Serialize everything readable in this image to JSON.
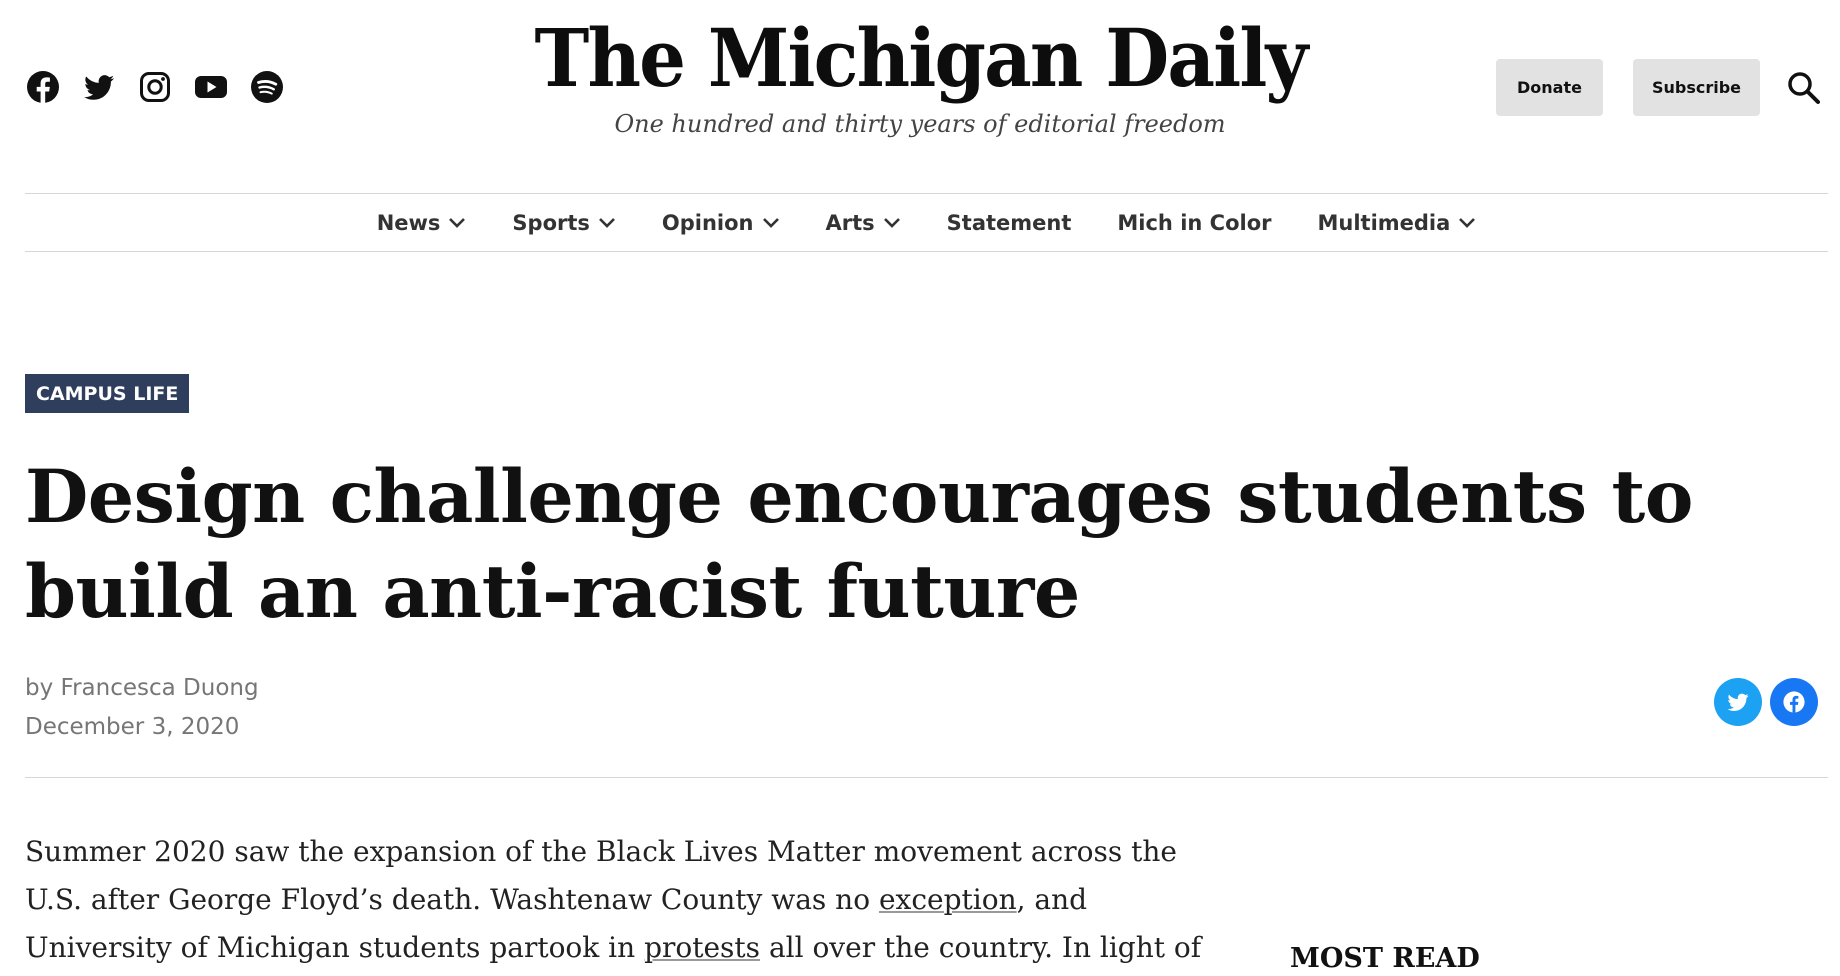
{
  "header": {
    "site_title": "The Michigan Daily",
    "tagline": "One hundred and thirty years of editorial freedom",
    "donate_label": "Donate",
    "subscribe_label": "Subscribe",
    "social_icons": [
      "facebook-icon",
      "twitter-icon",
      "instagram-icon",
      "youtube-icon",
      "spotify-icon"
    ],
    "search_icon": "search-icon"
  },
  "nav": {
    "items": [
      {
        "label": "News",
        "has_dropdown": true
      },
      {
        "label": "Sports",
        "has_dropdown": true
      },
      {
        "label": "Opinion",
        "has_dropdown": true
      },
      {
        "label": "Arts",
        "has_dropdown": true
      },
      {
        "label": "Statement",
        "has_dropdown": false
      },
      {
        "label": "Mich in Color",
        "has_dropdown": false
      },
      {
        "label": "Multimedia",
        "has_dropdown": true
      }
    ]
  },
  "article": {
    "category": "CAMPUS LIFE",
    "title": "Design challenge encourages students to build an anti-racist future",
    "byline_prefix": "by",
    "author": "Francesca Duong",
    "date": "December 3, 2020",
    "body": {
      "t1": "Summer 2020 saw the expansion of the Black Lives Matter movement across the U.S. after George Floyd’s death. Washtenaw County was no ",
      "link1": "exception",
      "t2": ", and University of Michigan students partook in ",
      "link2": "protests",
      "t3": " all over the country. In light of"
    }
  },
  "share": {
    "twitter_color": "#1da1f2",
    "facebook_color": "#1877f2"
  },
  "sidebar": {
    "most_read_heading": "MOST READ"
  },
  "colors": {
    "category_bg": "#2f3e5c",
    "button_bg": "#e2e2e2",
    "meta_text": "#767676"
  }
}
